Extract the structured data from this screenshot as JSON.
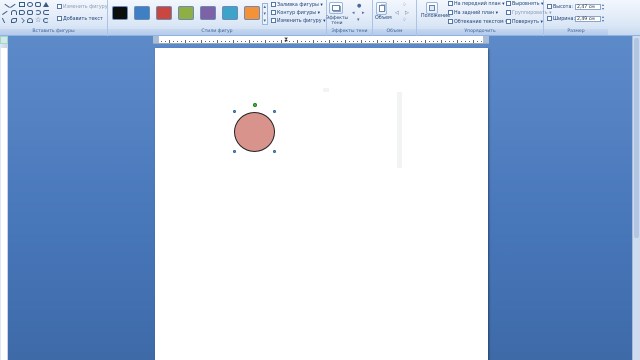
{
  "ribbon": {
    "insert_shapes": {
      "label": "Вставить фигуры",
      "edit_shape": "Изменить фигуру",
      "add_text": "Добавить текст"
    },
    "shape_styles": {
      "label": "Стили фигур",
      "swatches": [
        "#0d0d0d",
        "#3f7fc4",
        "#c9473f",
        "#8faf45",
        "#7d62a8",
        "#3ea3c9",
        "#f39237"
      ],
      "fill": "Заливка фигуры",
      "outline": "Контур фигуры",
      "change": "Изменить фигуру"
    },
    "shadow_effects": {
      "label": "Эффекты тени",
      "button": "Эффекты тени"
    },
    "volume": {
      "label": "Объем",
      "button": "Объем"
    },
    "arrange": {
      "label": "Упорядочить",
      "position": "Положение",
      "to_front": "На передний план",
      "to_back": "На задний план",
      "wrap": "Обтекание текстом",
      "align": "Выровнять",
      "group": "Группировать",
      "rotate": "Повернуть"
    },
    "size": {
      "label": "Размер",
      "height_label": "Высота:",
      "height_value": "2,47 см",
      "width_label": "Ширина:",
      "width_value": "2,49 см"
    }
  },
  "shape": {
    "fill": "#d8948c",
    "outline": "#222222"
  },
  "colors": {
    "ribbon_bg": "#dbe7f6",
    "workspace": "#4776b9",
    "selection_handle": "#6fa0d8",
    "rotation_handle": "#3cc33c"
  }
}
